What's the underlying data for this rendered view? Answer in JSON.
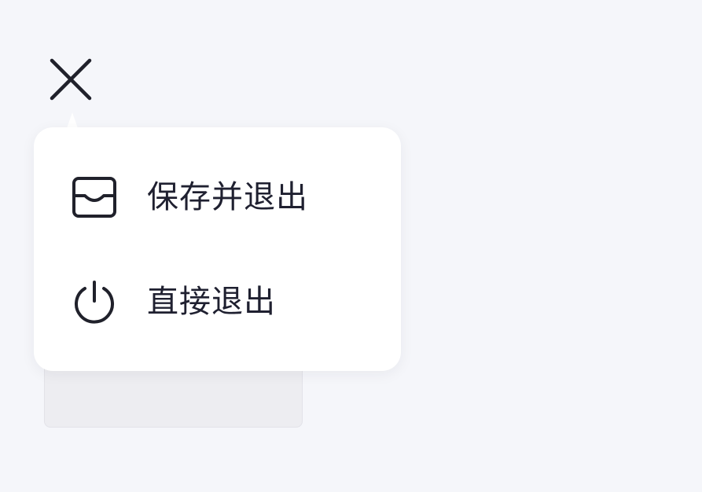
{
  "header": {
    "close_icon": "close-icon"
  },
  "menu": {
    "items": [
      {
        "label": "保存并退出",
        "icon": "inbox-tray-icon"
      },
      {
        "label": "直接退出",
        "icon": "power-icon"
      }
    ]
  },
  "colors": {
    "background": "#f5f6fa",
    "popover": "#ffffff",
    "text": "#1f2030",
    "icon": "#20212b",
    "underlay_card": "#ededf1"
  }
}
